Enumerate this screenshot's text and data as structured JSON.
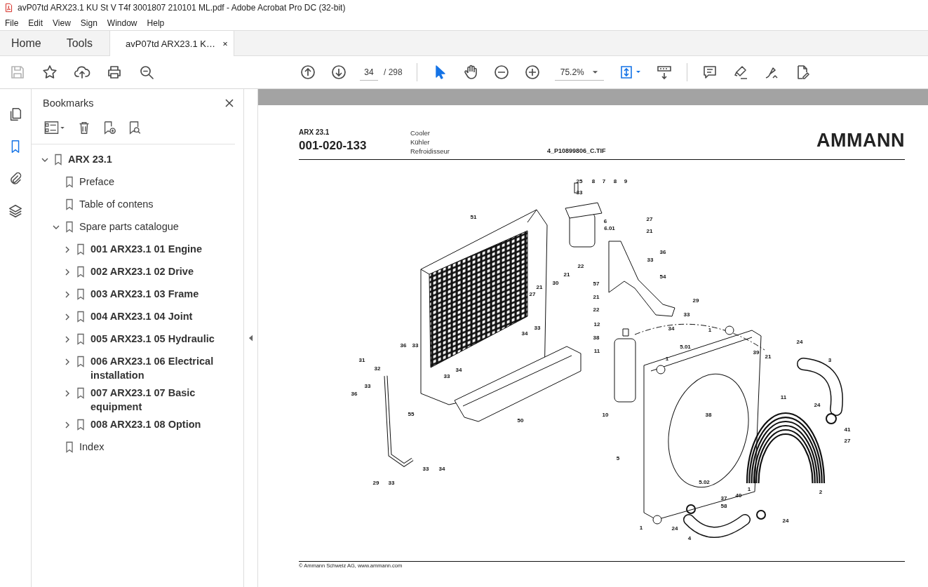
{
  "window": {
    "title": "avP07td ARX23.1 KU St V T4f 3001807 210101 ML.pdf - Adobe Acrobat Pro DC (32-bit)"
  },
  "menu": [
    "File",
    "Edit",
    "View",
    "Sign",
    "Window",
    "Help"
  ],
  "tabs": [
    {
      "label": "Home",
      "kind": "nav",
      "selected": false
    },
    {
      "label": "Tools",
      "kind": "nav",
      "selected": false
    },
    {
      "label": "avP07td ARX23.1 K…",
      "kind": "document",
      "selected": true
    }
  ],
  "toolbar": {
    "left_tools": [
      {
        "kind": "save",
        "disabled": true
      },
      {
        "kind": "star",
        "disabled": false
      },
      {
        "kind": "upload",
        "disabled": false
      },
      {
        "kind": "print",
        "disabled": false
      },
      {
        "kind": "zoom-search",
        "disabled": false
      }
    ],
    "page": "34",
    "page_count": "/ 298",
    "zoom": "75.2%",
    "pointer_tools": [
      {
        "kind": "select",
        "selected": true
      },
      {
        "kind": "hand",
        "selected": false
      }
    ],
    "right_tools": [
      {
        "kind": "comment"
      },
      {
        "kind": "highlight"
      },
      {
        "kind": "sign"
      },
      {
        "kind": "edit"
      }
    ]
  },
  "rail": [
    {
      "kind": "pages",
      "selected": false
    },
    {
      "kind": "bookmarks",
      "selected": true
    },
    {
      "kind": "attachments",
      "selected": false
    },
    {
      "kind": "layers",
      "selected": false
    }
  ],
  "bookmarks": {
    "title": "Bookmarks",
    "items": [
      {
        "label": "ARX 23.1",
        "kind": "folder",
        "expanded": true,
        "bold": true,
        "children": [
          {
            "label": "Preface",
            "kind": "page",
            "bold": false
          },
          {
            "label": "Table of contens",
            "kind": "page",
            "bold": false
          },
          {
            "label": "Spare parts catalogue",
            "kind": "folder",
            "expanded": true,
            "bold": false,
            "children": [
              {
                "label": "001 ARX23.1 01 Engine",
                "kind": "folder",
                "expanded": false,
                "bold": true
              },
              {
                "label": "002 ARX23.1 02 Drive",
                "kind": "folder",
                "expanded": false,
                "bold": true
              },
              {
                "label": "003 ARX23.1 03 Frame",
                "kind": "folder",
                "expanded": false,
                "bold": true
              },
              {
                "label": "004 ARX23.1 04 Joint",
                "kind": "folder",
                "expanded": false,
                "bold": true
              },
              {
                "label": "005 ARX23.1 05 Hydraulic",
                "kind": "folder",
                "expanded": false,
                "bold": true
              },
              {
                "label": "006 ARX23.1 06 Electrical installation",
                "kind": "folder",
                "expanded": false,
                "bold": true
              },
              {
                "label": "007 ARX23.1 07 Basic equipment",
                "kind": "folder",
                "expanded": false,
                "bold": true
              },
              {
                "label": "008 ARX23.1 08 Option",
                "kind": "folder",
                "expanded": false,
                "bold": true
              }
            ]
          },
          {
            "label": "Index",
            "kind": "page",
            "bold": false
          }
        ]
      }
    ]
  },
  "document": {
    "model": "ARX 23.1",
    "number": "001-020-133",
    "names": [
      "Cooler",
      "Kühler",
      "Refroidisseur"
    ],
    "file": "4_P10899806_C.TIF",
    "logo": "AMMANN",
    "callouts": [
      "25",
      "33",
      "8",
      "7",
      "8",
      "9",
      "51",
      "6",
      "6.01",
      "27",
      "21",
      "36",
      "33",
      "22",
      "21",
      "30",
      "57",
      "54",
      "27",
      "21",
      "21",
      "29",
      "22",
      "33",
      "33",
      "12",
      "34",
      "34",
      "38",
      "1",
      "5.01",
      "11",
      "39",
      "21",
      "24",
      "3",
      "1",
      "36",
      "33",
      "31",
      "32",
      "34",
      "33",
      "33",
      "36",
      "38",
      "11",
      "24",
      "10",
      "50",
      "55",
      "41",
      "27",
      "5",
      "33",
      "34",
      "29",
      "33",
      "5.02",
      "1",
      "40",
      "37",
      "58",
      "2",
      "1",
      "24",
      "24",
      "4"
    ],
    "footer": "© Ammann Schweiz AG, www.ammann.com"
  }
}
